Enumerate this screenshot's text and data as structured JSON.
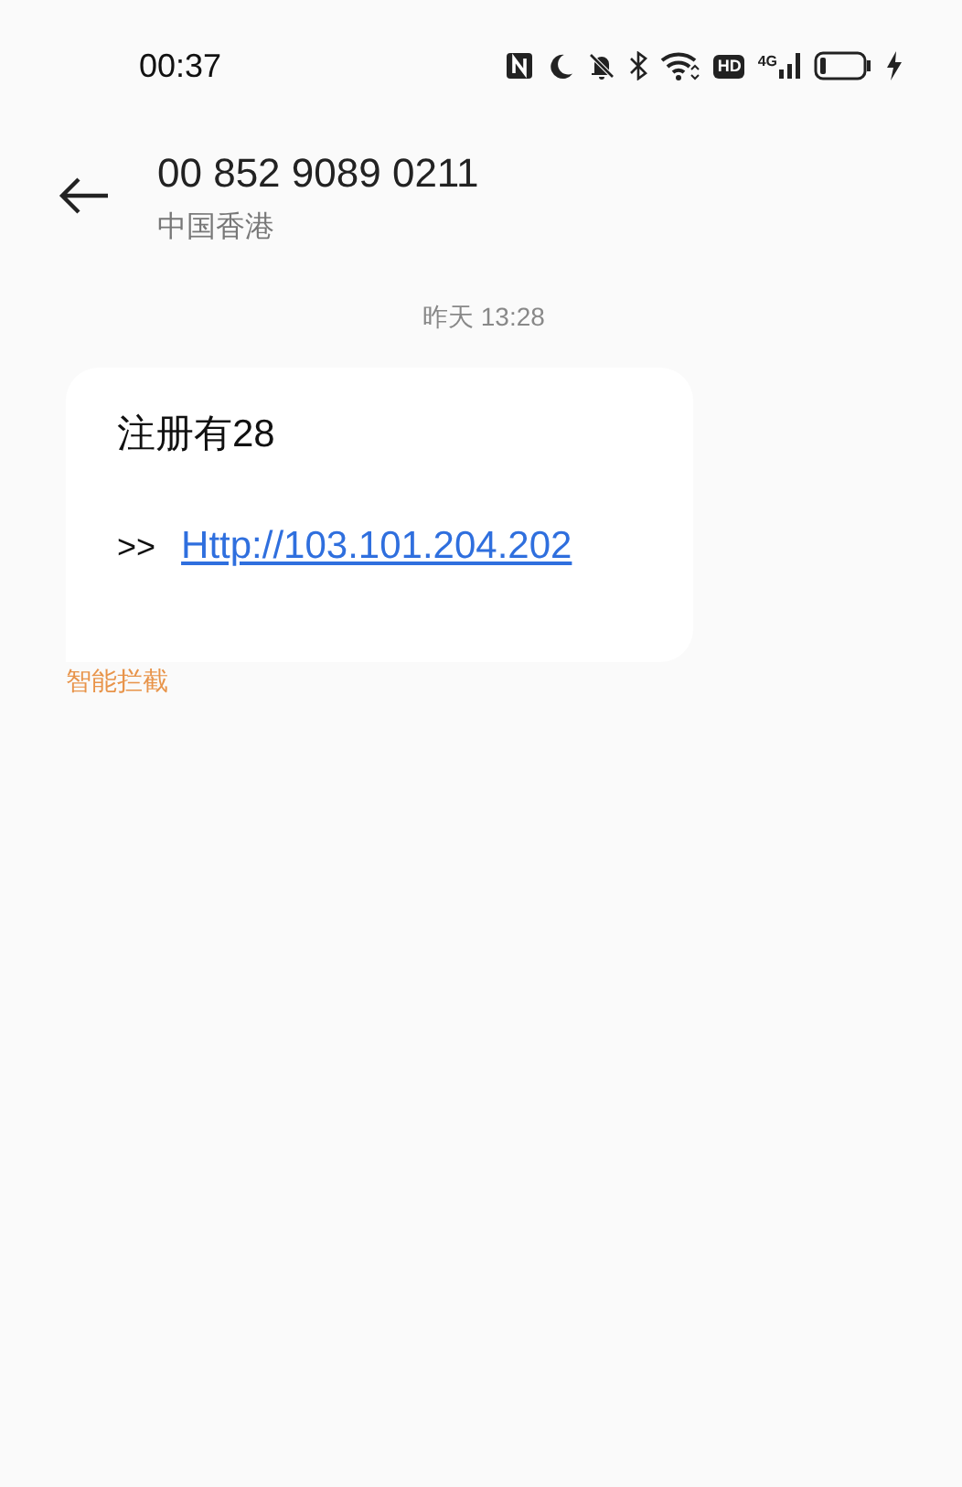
{
  "status_bar": {
    "time": "00:37",
    "hd_label": "HD",
    "network_label": "4G"
  },
  "header": {
    "title": "00 852 9089 0211",
    "subtitle": "中国香港"
  },
  "messages": [
    {
      "timestamp": "昨天 13:28",
      "text": "注册有28",
      "link_prefix": ">>",
      "link": "Http://103.101.204.202",
      "tag": "智能拦截"
    }
  ]
}
